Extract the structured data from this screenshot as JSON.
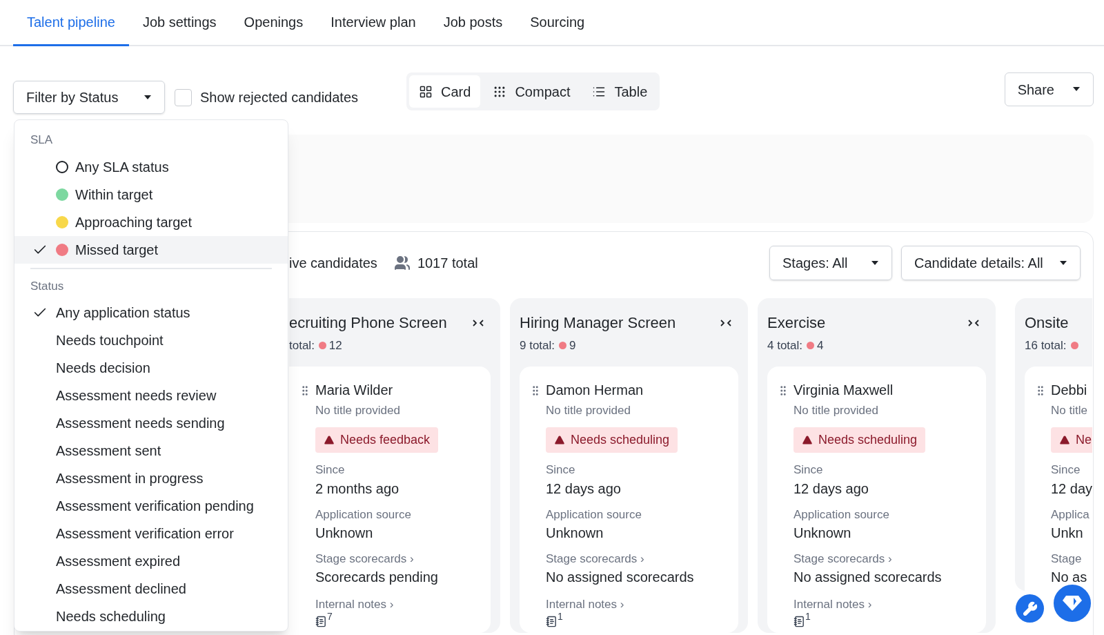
{
  "tabs": [
    {
      "label": "Talent pipeline",
      "selected": true
    },
    {
      "label": "Job settings",
      "selected": false
    },
    {
      "label": "Openings",
      "selected": false
    },
    {
      "label": "Interview plan",
      "selected": false
    },
    {
      "label": "Job posts",
      "selected": false
    },
    {
      "label": "Sourcing",
      "selected": false
    }
  ],
  "filter_button": {
    "label": "Filter by Status"
  },
  "show_rejected": {
    "label": "Show rejected candidates",
    "checked": false
  },
  "view_modes": [
    {
      "kind": "card",
      "label": "Card",
      "selected": true
    },
    {
      "kind": "compact",
      "label": "Compact",
      "selected": false
    },
    {
      "kind": "table",
      "label": "Table",
      "selected": false
    }
  ],
  "share_button": {
    "label": "Share"
  },
  "board": {
    "candidates_label": "ive candidates",
    "total": "1017 total",
    "stages_button": "Stages: All",
    "details_button": "Candidate details: All",
    "columns": [
      {
        "title": "ecruiting Phone Screen",
        "total_label": "total:",
        "count": "12",
        "candidate": {
          "name": "Maria Wilder",
          "title": "No title provided",
          "flag": "Needs feedback",
          "since_label": "Since",
          "since": "2 months ago",
          "source_label": "Application source",
          "source": "Unknown",
          "scorecards_label": "Stage scorecards ›",
          "scorecards": "Scorecards pending",
          "notes_label": "Internal notes ›",
          "notes_count": "7"
        }
      },
      {
        "title": "Hiring Manager Screen",
        "total_label": "9 total:",
        "count": "9",
        "candidate": {
          "name": "Damon Herman",
          "title": "No title provided",
          "flag": "Needs scheduling",
          "since_label": "Since",
          "since": "12 days ago",
          "source_label": "Application source",
          "source": "Unknown",
          "scorecards_label": "Stage scorecards ›",
          "scorecards": "No assigned scorecards",
          "notes_label": "Internal notes ›",
          "notes_count": "1"
        }
      },
      {
        "title": "Exercise",
        "total_label": "4 total:",
        "count": "4",
        "candidate": {
          "name": "Virginia Maxwell",
          "title": "No title provided",
          "flag": "Needs scheduling",
          "since_label": "Since",
          "since": "12 days ago",
          "source_label": "Application source",
          "source": "Unknown",
          "scorecards_label": "Stage scorecards ›",
          "scorecards": "No assigned scorecards",
          "notes_label": "Internal notes ›",
          "notes_count": "1"
        }
      },
      {
        "title": "Onsite",
        "total_label": "16 total:",
        "candidate": {
          "name": "Debbi",
          "title": "No title",
          "flag": "Ne",
          "since_label": "Since",
          "since": "12 day",
          "source_label": "Applica",
          "source": "Unkn",
          "scorecards_label": "Stage",
          "scorecards": "No as"
        }
      }
    ]
  },
  "status_menu": {
    "sections": [
      {
        "heading": "SLA",
        "items": [
          {
            "label": "Any SLA status",
            "kind": "ring",
            "checked": false,
            "highlighted": false
          },
          {
            "label": "Within target",
            "kind": "dot",
            "color": "#7dd8a0",
            "checked": false,
            "highlighted": false
          },
          {
            "label": "Approaching target",
            "kind": "dot",
            "color": "#f8d84a",
            "checked": false,
            "highlighted": false
          },
          {
            "label": "Missed target",
            "kind": "dot",
            "color": "#f07b84",
            "checked": true,
            "highlighted": true
          }
        ]
      },
      {
        "heading": "Status",
        "items": [
          {
            "label": "Any application status",
            "kind": "plain",
            "checked": true,
            "highlighted": false
          },
          {
            "label": "Needs touchpoint",
            "kind": "plain",
            "checked": false,
            "highlighted": false
          },
          {
            "label": "Needs decision",
            "kind": "plain",
            "checked": false,
            "highlighted": false
          },
          {
            "label": "Assessment needs review",
            "kind": "plain",
            "checked": false,
            "highlighted": false
          },
          {
            "label": "Assessment needs sending",
            "kind": "plain",
            "checked": false,
            "highlighted": false
          },
          {
            "label": "Assessment sent",
            "kind": "plain",
            "checked": false,
            "highlighted": false
          },
          {
            "label": "Assessment in progress",
            "kind": "plain",
            "checked": false,
            "highlighted": false
          },
          {
            "label": "Assessment verification pending",
            "kind": "plain",
            "checked": false,
            "highlighted": false
          },
          {
            "label": "Assessment verification error",
            "kind": "plain",
            "checked": false,
            "highlighted": false
          },
          {
            "label": "Assessment expired",
            "kind": "plain",
            "checked": false,
            "highlighted": false
          },
          {
            "label": "Assessment declined",
            "kind": "plain",
            "checked": false,
            "highlighted": false
          },
          {
            "label": "Needs scheduling",
            "kind": "plain",
            "checked": false,
            "highlighted": false
          }
        ]
      }
    ]
  }
}
